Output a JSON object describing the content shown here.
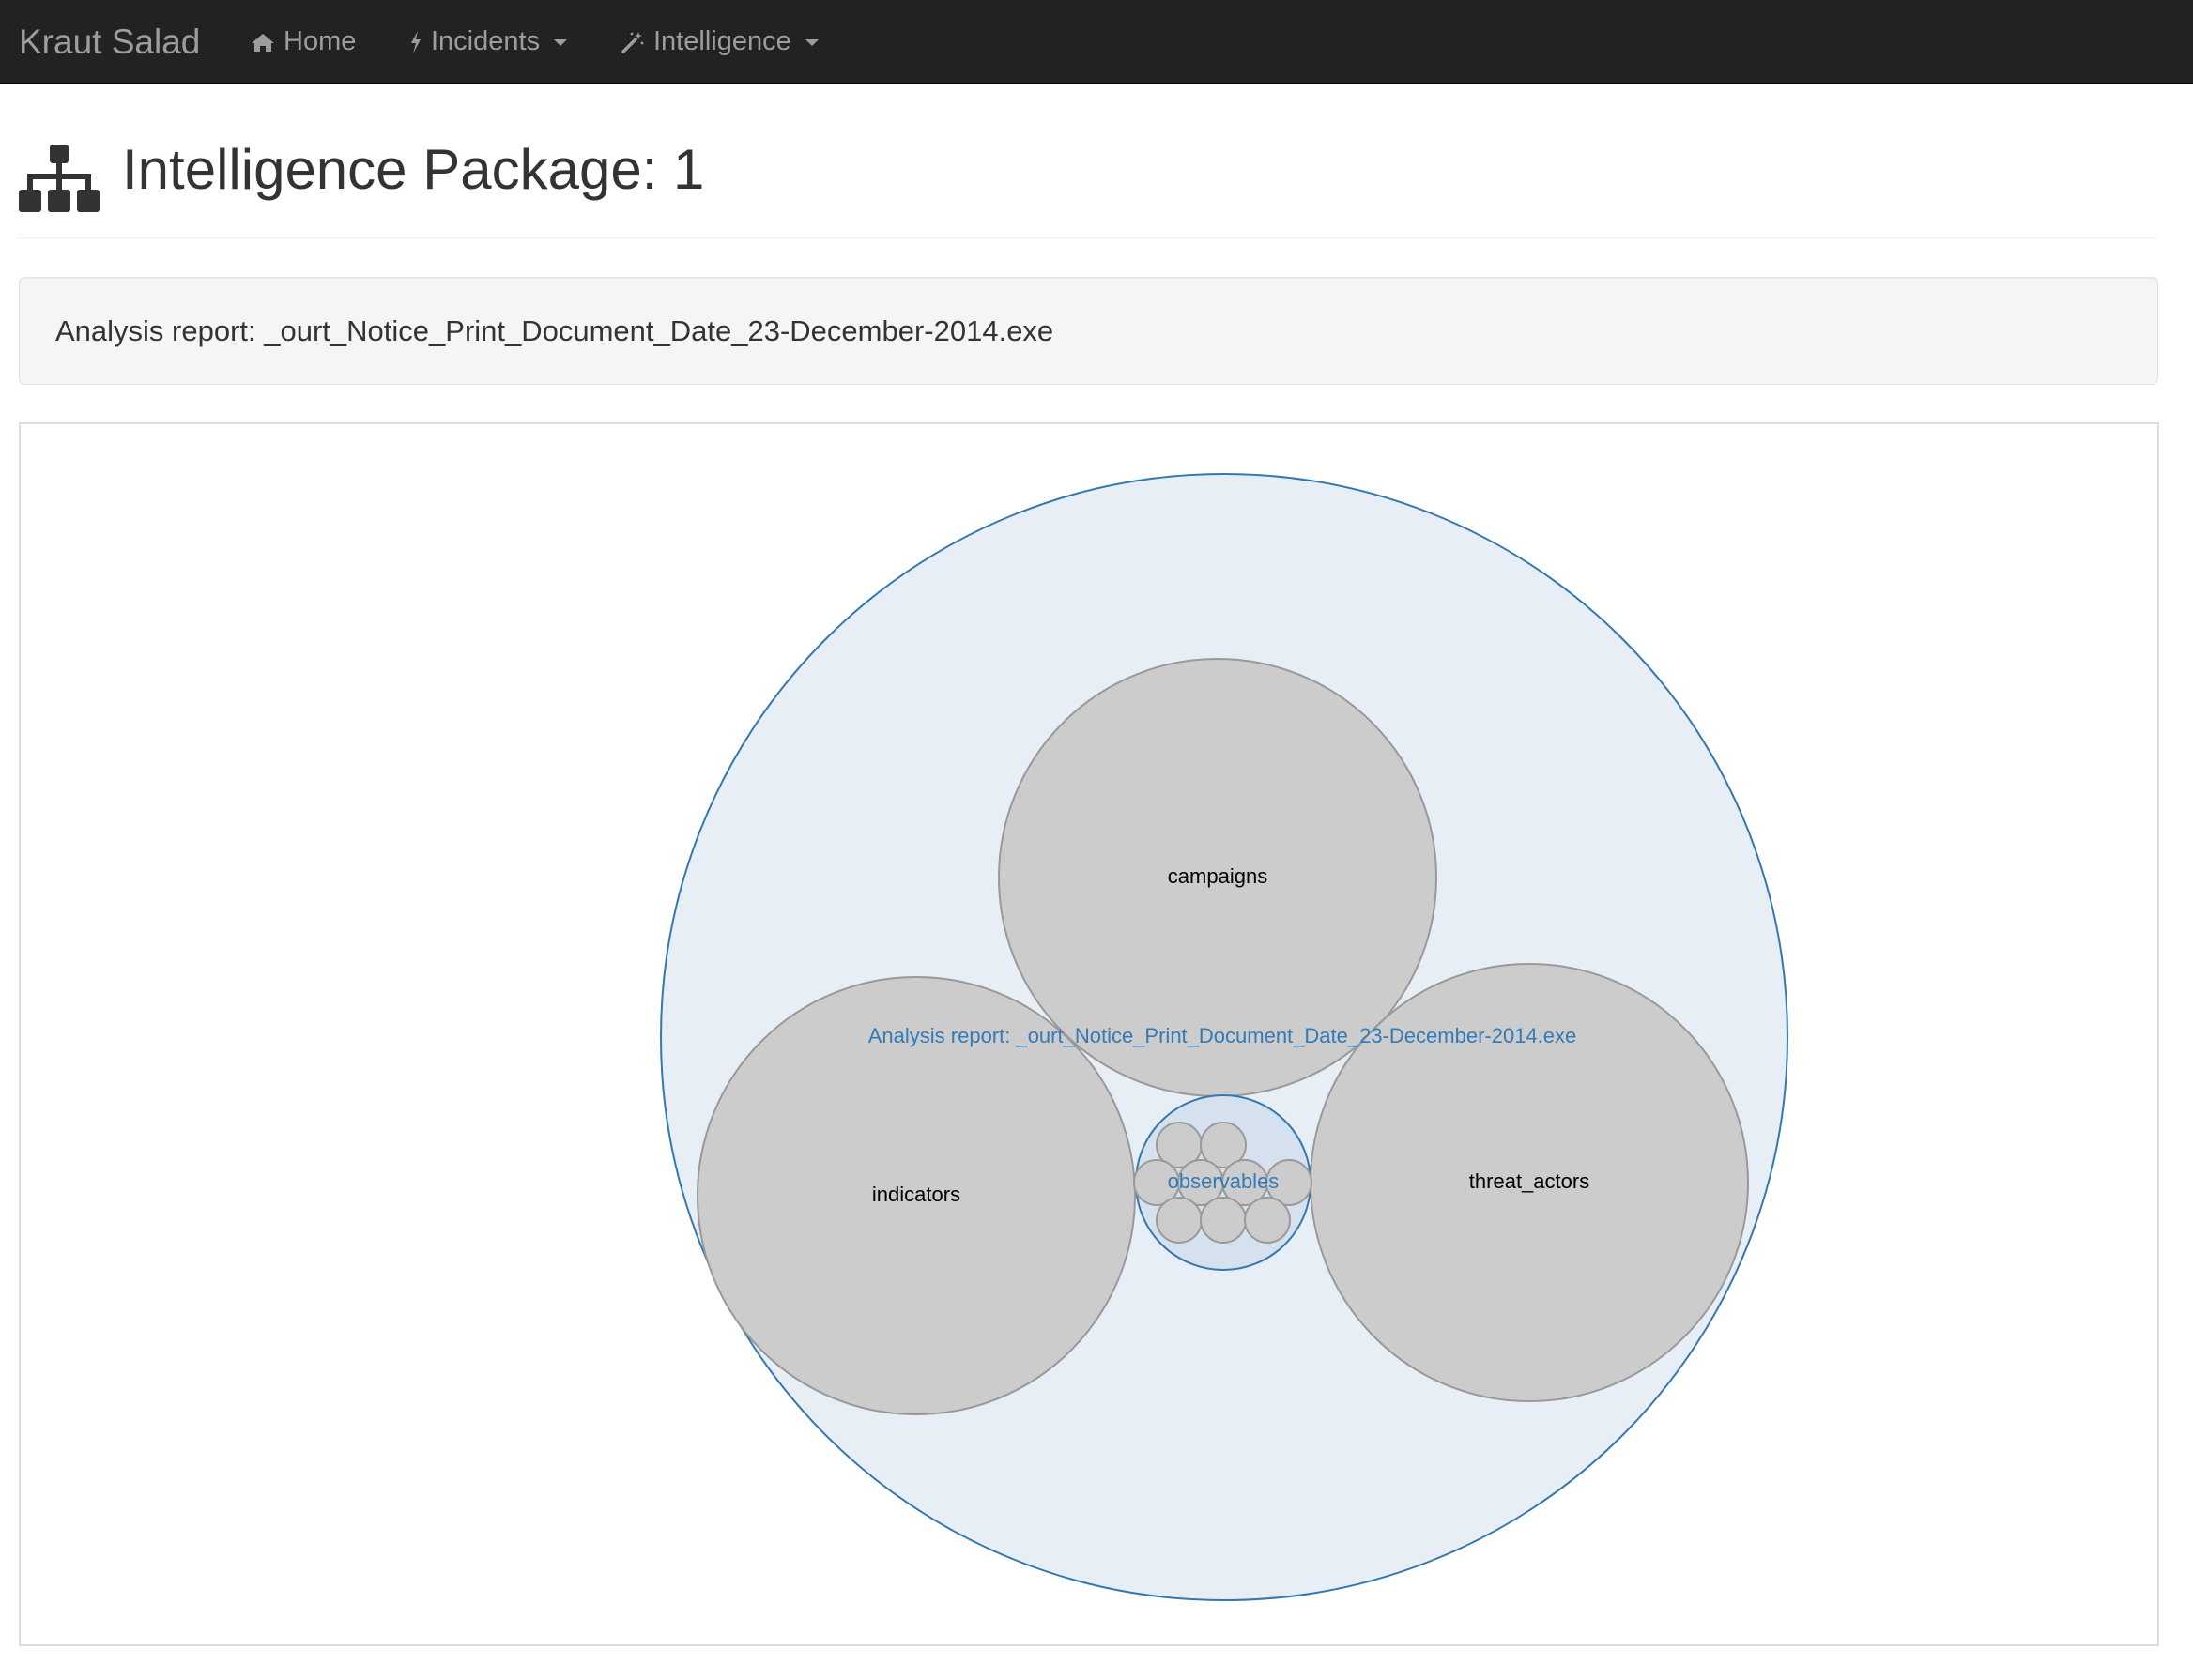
{
  "navbar": {
    "brand": "Kraut Salad",
    "items": [
      {
        "label": "Home",
        "icon": "home-icon",
        "dropdown": false
      },
      {
        "label": "Incidents",
        "icon": "bolt-icon",
        "dropdown": true
      },
      {
        "label": "Intelligence",
        "icon": "magic-wand-icon",
        "dropdown": true
      }
    ]
  },
  "page": {
    "title": "Intelligence Package: 1",
    "title_icon": "sitemap-icon"
  },
  "well": {
    "text": "Analysis report: _ourt_Notice_Print_Document_Date_23-December-2014.exe"
  },
  "bubble_pack": {
    "root_label": "Analysis report: _ourt_Notice_Print_Document_Date_23-December-2014.exe",
    "groups": [
      {
        "label": "campaigns",
        "children": 0
      },
      {
        "label": "indicators",
        "children": 0
      },
      {
        "label": "threat_actors",
        "children": 0
      },
      {
        "label": "observables",
        "children": 10
      }
    ]
  },
  "colors": {
    "navbar_bg": "#222222",
    "nav_text": "#9d9d9d",
    "root_fill": "#e8eef6",
    "root_stroke": "#3478ad",
    "node_fill": "#cccccc",
    "node_stroke": "#999999",
    "observables_fill": "#d5e1ef",
    "link_text": "#337ab7"
  }
}
